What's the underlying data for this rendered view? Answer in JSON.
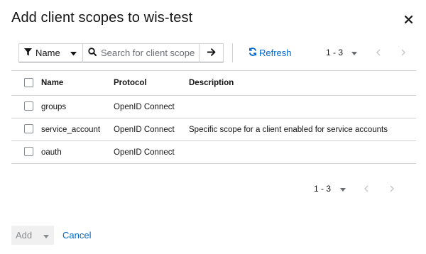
{
  "modal": {
    "title": "Add client scopes to wis-test"
  },
  "toolbar": {
    "filter_label": "Name",
    "search_placeholder": "Search for client scope",
    "refresh_label": "Refresh"
  },
  "pagination": {
    "range": "1 - 3"
  },
  "table": {
    "headers": [
      "Name",
      "Protocol",
      "Description"
    ],
    "rows": [
      {
        "name": "groups",
        "protocol": "OpenID Connect",
        "description": ""
      },
      {
        "name": "service_account",
        "protocol": "OpenID Connect",
        "description": "Specific scope for a client enabled for service accounts"
      },
      {
        "name": "oauth",
        "protocol": "OpenID Connect",
        "description": ""
      }
    ]
  },
  "footer": {
    "add_label": "Add",
    "cancel_label": "Cancel"
  },
  "colors": {
    "link": "#0066cc",
    "border": "#d2d2d2",
    "text": "#151515",
    "disabled": "#8a8d90"
  },
  "icons": [
    "close-icon",
    "filter-icon",
    "caret-down-icon",
    "search-icon",
    "arrow-right-icon",
    "refresh-icon",
    "angle-left-icon",
    "angle-right-icon"
  ]
}
